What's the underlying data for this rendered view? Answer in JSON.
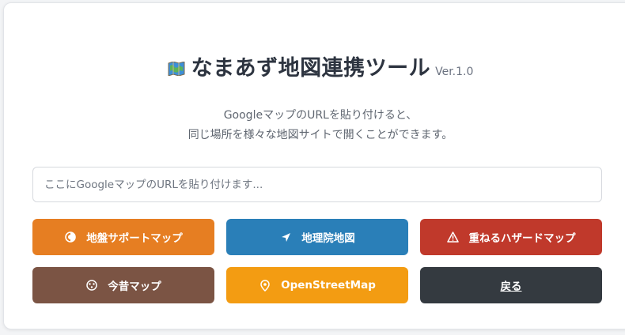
{
  "header": {
    "icon": "map-icon",
    "title": "なまあず地図連携ツール",
    "version": "Ver.1.0"
  },
  "description": {
    "line1": "GoogleマップのURLを貼り付けると、",
    "line2": "同じ場所を様々な地図サイトで開くことができます。"
  },
  "url_input": {
    "value": "",
    "placeholder": "ここにGoogleマップのURLを貼り付けます..."
  },
  "buttons": [
    {
      "label": "地盤サポートマップ",
      "icon": "circle-half-icon",
      "color": "#e67e22"
    },
    {
      "label": "地理院地図",
      "icon": "location-arrow-icon",
      "color": "#2a7fb8"
    },
    {
      "label": "重ねるハザードマップ",
      "icon": "warning-triangle-icon",
      "color": "#c0392b"
    },
    {
      "label": "今昔マップ",
      "icon": "history-icon",
      "color": "#7b5444"
    },
    {
      "label": "OpenStreetMap",
      "icon": "map-pin-icon",
      "color": "#f39c12"
    },
    {
      "label": "戻る",
      "icon": "",
      "color": "#343a40"
    }
  ]
}
